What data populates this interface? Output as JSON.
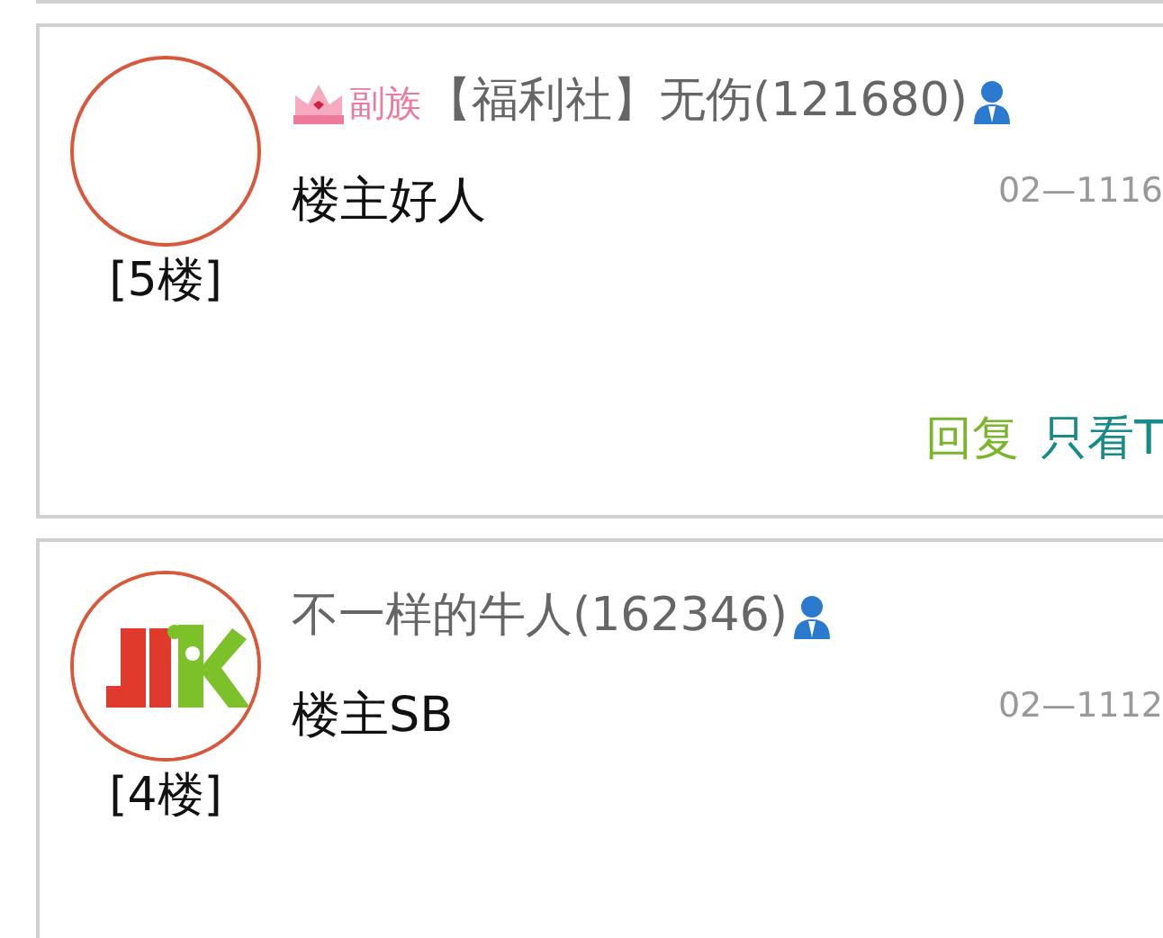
{
  "posts": [
    {
      "avatar": {
        "kind": "empty"
      },
      "floor": "[5楼]",
      "badge": "副族",
      "name": "【福利社】无伤(121680)",
      "date": "02—1116",
      "content": "楼主好人",
      "actions": [
        {
          "label": "回复",
          "kind": "reply"
        },
        {
          "label": "只看T",
          "kind": "only"
        }
      ]
    },
    {
      "floor": "[4楼]",
      "name": "不一样的牛人(162346)",
      "date": "02—1112",
      "content": "楼主SB"
    }
  ]
}
